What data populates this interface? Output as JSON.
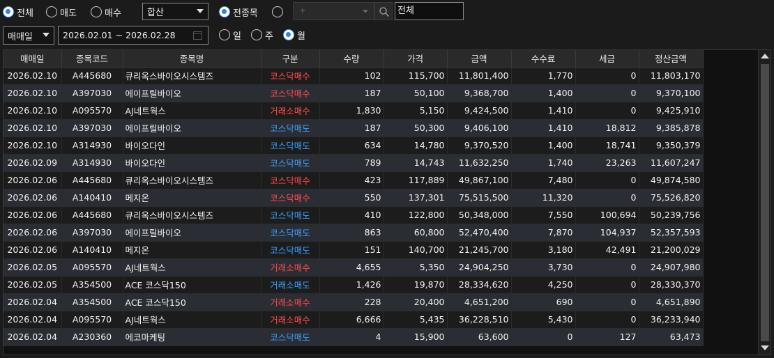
{
  "filters": {
    "trade_type": {
      "options": [
        "전체",
        "매도",
        "매수"
      ],
      "selected": "전체"
    },
    "aggregate_select": "합산",
    "stock_scope": {
      "all_label": "전종목",
      "selected": "전종목"
    },
    "stock_code_placeholder": "+",
    "stock_name_value": "전체",
    "date_basis_select": "매매일",
    "date_range": "2026.02.01 ~ 2026.02.28",
    "period": {
      "options": [
        "일",
        "주",
        "월"
      ],
      "selected": "월"
    }
  },
  "table": {
    "columns": [
      "매매일",
      "종목코드",
      "종목명",
      "구분",
      "수량",
      "가격",
      "금액",
      "수수료",
      "세금",
      "정산금액"
    ],
    "rows": [
      [
        "2026.02.10",
        "A445680",
        "큐리옥스바이오시스템즈",
        "코스닥매수",
        "102",
        "115,700",
        "11,801,400",
        "1,770",
        "0",
        "11,803,170"
      ],
      [
        "2026.02.10",
        "A397030",
        "에이프릴바이오",
        "코스닥매수",
        "187",
        "50,100",
        "9,368,700",
        "1,400",
        "0",
        "9,370,100"
      ],
      [
        "2026.02.10",
        "A095570",
        "AJ네트웍스",
        "거래소매수",
        "1,830",
        "5,150",
        "9,424,500",
        "1,410",
        "0",
        "9,425,910"
      ],
      [
        "2026.02.10",
        "A397030",
        "에이프릴바이오",
        "코스닥매도",
        "187",
        "50,300",
        "9,406,100",
        "1,410",
        "18,812",
        "9,385,878"
      ],
      [
        "2026.02.10",
        "A314930",
        "바이오다인",
        "코스닥매도",
        "634",
        "14,780",
        "9,370,520",
        "1,400",
        "18,741",
        "9,350,379"
      ],
      [
        "2026.02.09",
        "A314930",
        "바이오다인",
        "코스닥매도",
        "789",
        "14,743",
        "11,632,250",
        "1,740",
        "23,263",
        "11,607,247"
      ],
      [
        "2026.02.06",
        "A445680",
        "큐리옥스바이오시스템즈",
        "코스닥매수",
        "423",
        "117,889",
        "49,867,100",
        "7,480",
        "0",
        "49,874,580"
      ],
      [
        "2026.02.06",
        "A140410",
        "메지온",
        "코스닥매수",
        "550",
        "137,301",
        "75,515,500",
        "11,320",
        "0",
        "75,526,820"
      ],
      [
        "2026.02.06",
        "A445680",
        "큐리옥스바이오시스템즈",
        "코스닥매도",
        "410",
        "122,800",
        "50,348,000",
        "7,550",
        "100,694",
        "50,239,756"
      ],
      [
        "2026.02.06",
        "A397030",
        "에이프릴바이오",
        "코스닥매도",
        "863",
        "60,800",
        "52,470,400",
        "7,870",
        "104,937",
        "52,357,593"
      ],
      [
        "2026.02.06",
        "A140410",
        "메지온",
        "코스닥매도",
        "151",
        "140,700",
        "21,245,700",
        "3,180",
        "42,491",
        "21,200,029"
      ],
      [
        "2026.02.05",
        "A095570",
        "AJ네트웍스",
        "거래소매수",
        "4,655",
        "5,350",
        "24,904,250",
        "3,730",
        "0",
        "24,907,980"
      ],
      [
        "2026.02.05",
        "A354500",
        "ACE 코스닥150",
        "거래소매도",
        "1,426",
        "19,870",
        "28,334,620",
        "4,250",
        "0",
        "28,330,370"
      ],
      [
        "2026.02.04",
        "A354500",
        "ACE 코스닥150",
        "거래소매수",
        "228",
        "20,400",
        "4,651,200",
        "690",
        "0",
        "4,651,890"
      ],
      [
        "2026.02.04",
        "A095570",
        "AJ네트웍스",
        "거래소매수",
        "6,666",
        "5,435",
        "36,228,510",
        "5,430",
        "0",
        "36,233,940"
      ],
      [
        "2026.02.04",
        "A230360",
        "에코마케팅",
        "코스닥매도",
        "4",
        "15,900",
        "63,600",
        "0",
        "127",
        "63,473"
      ]
    ]
  },
  "colors": {
    "buy": "#ff4b4b",
    "sell": "#3aa0ff",
    "accent": "#2f7df0"
  },
  "icons": {
    "search": "search-icon",
    "calendar": "calendar-icon",
    "dropdown": "chevron-down-icon"
  }
}
